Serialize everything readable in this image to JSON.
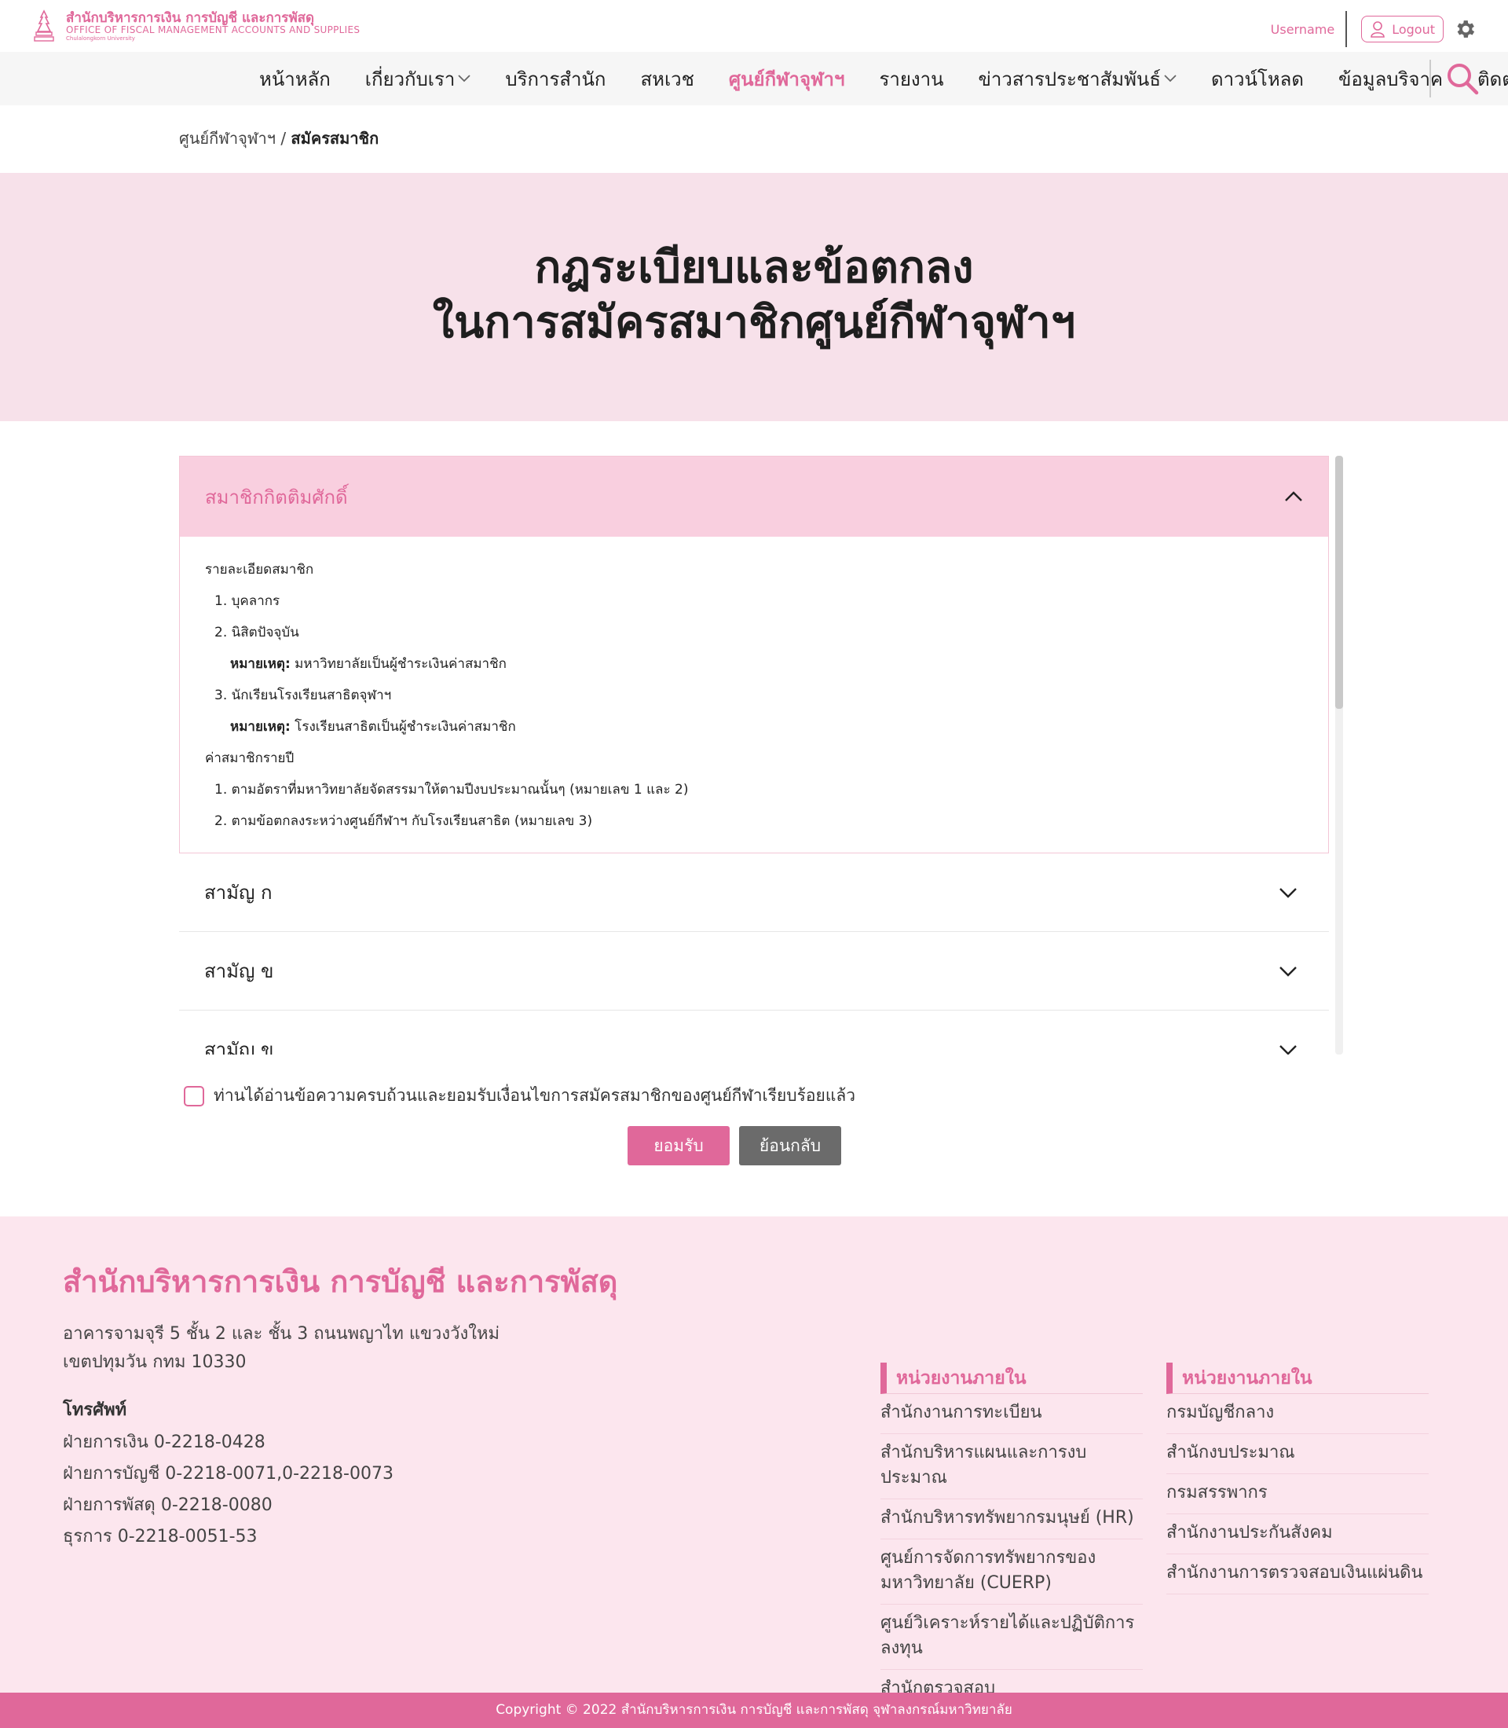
{
  "header": {
    "logo_th": "สำนักบริหารการเงิน การบัญชี และการพัสดุ",
    "logo_en": "OFFICE OF FISCAL MANAGEMENT ACCOUNTS AND SUPPLIES",
    "logo_uni": "Chulalongkorn University",
    "username": "Username",
    "logout_label": "Logout",
    "accent_color": "#e0689a"
  },
  "nav": {
    "items": [
      {
        "label": "หน้าหลัก"
      },
      {
        "label": "เกี่ยวกับเรา"
      },
      {
        "label": "บริการสำนัก"
      },
      {
        "label": "สหเวช"
      },
      {
        "label": "ศูนย์กีฬาจุฬาฯ"
      },
      {
        "label": "รายงาน"
      },
      {
        "label": "ข่าวสารประชาสัมพันธ์"
      },
      {
        "label": "ดาวน์โหลด"
      },
      {
        "label": "ข้อมูลบริจาค"
      },
      {
        "label": "ติดต่อเรา"
      }
    ]
  },
  "breadcrumb": {
    "parent": "ศูนย์กีฬาจุฬาฯ",
    "separator": "/",
    "current": "สมัครสมาชิก"
  },
  "hero": {
    "line1": "กฎระเบียบและข้อตกลง",
    "line2": "ในการสมัครสมาชิกศูนย์กีฬาจุฬาฯ"
  },
  "accordion": {
    "open": {
      "title": "สมาชิกกิตติมศักดิ์",
      "lines": {
        "l1": "รายละเอียดสมาชิก",
        "l2": "1. บุคลากร",
        "l3": "2. นิสิตปัจจุบัน",
        "l4_bold": "หมายเหตุ:",
        "l4_text": " มหาวิทยาลัยเป็นผู้ชำระเงินค่าสมาชิก",
        "l5": "3.  นักเรียนโรงเรียนสาธิตจุฬาฯ",
        "l6_bold": "หมายเหตุ:",
        "l6_text": " โรงเรียนสาธิตเป็นผู้ชำระเงินค่าสมาชิก",
        "l7": "ค่าสมาชิกรายปี",
        "l8": "1. ตามอัตราที่มหาวิทยาลัยจัดสรรมาให้ตามปีงบประมาณนั้นๆ (หมายเลข 1 และ 2)",
        "l9": "2. ตามข้อตกลงระหว่างศูนย์กีฬาฯ กับโรงเรียนสาธิต (หมายเลข 3)"
      }
    },
    "closed": [
      "สามัญ ก",
      "สามัญ ข",
      "สามัญ ข"
    ]
  },
  "agreement": {
    "checkbox_label": "ท่านได้อ่านข้อความครบถ้วนและยอมรับเงื่อนไขการสมัครสมาชิกของศูนย์กีฬาเรียบร้อยแล้ว",
    "checked": false,
    "accept_label": "ยอมรับ",
    "back_label": "ย้อนกลับ"
  },
  "footer": {
    "title": "สำนักบริหารการเงิน การบัญชี และการพัสดุ",
    "address_line1": "อาคารจามจุรี 5 ชั้น 2 และ ชั้น 3 ถนนพญาไท แขวงวังใหม่",
    "address_line2": "เขตปทุมวัน กทม 10330",
    "phone_heading": "โทรศัพท์",
    "phones": [
      "ฝ่ายการเงิน 0-2218-0428",
      "ฝ่ายการบัญชี 0-2218-0071,0-2218-0073",
      "ฝ่ายการพัสดุ 0-2218-0080",
      "ธุรการ 0-2218-0051-53"
    ],
    "col1": {
      "heading": "หน่วยงานภายใน",
      "links": [
        "สำนักงานการทะเบียน",
        "สำนักบริหารแผนและการงบประมาณ",
        "สำนักบริหารทรัพยากรมนุษย์ (HR)",
        "ศูนย์การจัดการทรัพยากรของมหาวิทยาลัย (CUERP)",
        "ศูนย์วิเคราะห์รายได้และปฏิบัติการลงทุน",
        "สำนักตรวจสอบ"
      ]
    },
    "col2": {
      "heading": "หน่วยงานภายใน",
      "links": [
        "กรมบัญชีกลาง",
        "สำนักงบประมาณ",
        "กรมสรรพากร",
        "สำนักงานประกันสังคม",
        "สำนักงานการตรวจสอบเงินแผ่นดิน"
      ]
    },
    "copyright": "Copyright © 2022 สำนักบริหารการเงิน การบัญชี และการพัสดุ จุฬาลงกรณ์มหาวิทยาลัย"
  }
}
